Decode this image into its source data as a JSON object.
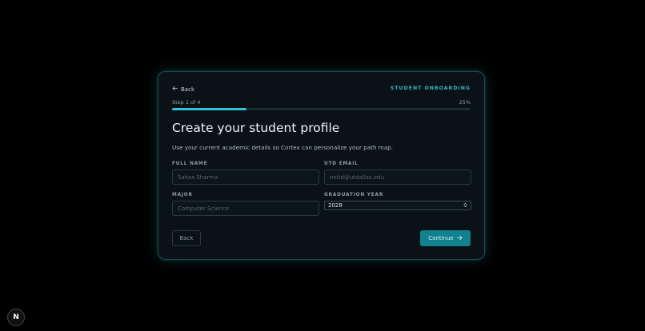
{
  "header": {
    "back_label": "Back",
    "eyebrow": "STUDENT ONBOARDING"
  },
  "progress": {
    "step_text": "Step 1 of 4",
    "percent_text": "25%",
    "fraction": 0.25
  },
  "main": {
    "title": "Create your student profile",
    "subtitle": "Use your current academic details so Cortex can personalize your path map."
  },
  "form": {
    "full_name": {
      "label": "FULL NAME",
      "placeholder": "Sahas Sharma"
    },
    "email": {
      "label": "UTD EMAIL",
      "placeholder": "netid@utdallas.edu"
    },
    "major": {
      "label": "MAJOR",
      "placeholder": "Computer Science"
    },
    "grad_year": {
      "label": "GRADUATION YEAR",
      "value": "2028"
    }
  },
  "actions": {
    "back_label": "Back",
    "continue_label": "Continue"
  },
  "badge": {
    "letter": "N"
  },
  "colors": {
    "accent": "#2fc4d8",
    "button": "#11808f",
    "card": "#0a1217",
    "background": "#000000"
  }
}
